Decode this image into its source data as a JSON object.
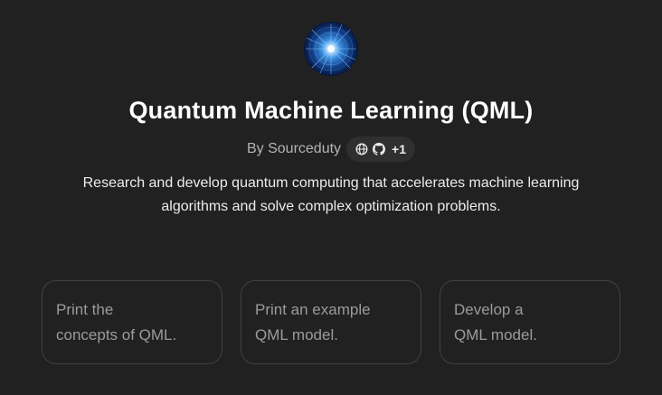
{
  "gpt": {
    "title": "Quantum Machine Learning (QML)",
    "author": "By Sourceduty",
    "links": {
      "icons": [
        "globe-icon",
        "github-icon"
      ],
      "more_count": "+1"
    },
    "description": "Research and develop quantum computing that accelerates machine learning algorithms and solve complex optimization problems."
  },
  "conversation_starters": [
    {
      "lines": [
        "Print the",
        "concepts of QML."
      ]
    },
    {
      "lines": [
        "Print an example",
        "QML model."
      ]
    },
    {
      "lines": [
        "Develop a",
        "QML model."
      ]
    }
  ],
  "colors": {
    "background": "#212121",
    "card_border": "#424242",
    "pill_background": "#2f2f2f",
    "starter_text": "#9b9b9b"
  }
}
